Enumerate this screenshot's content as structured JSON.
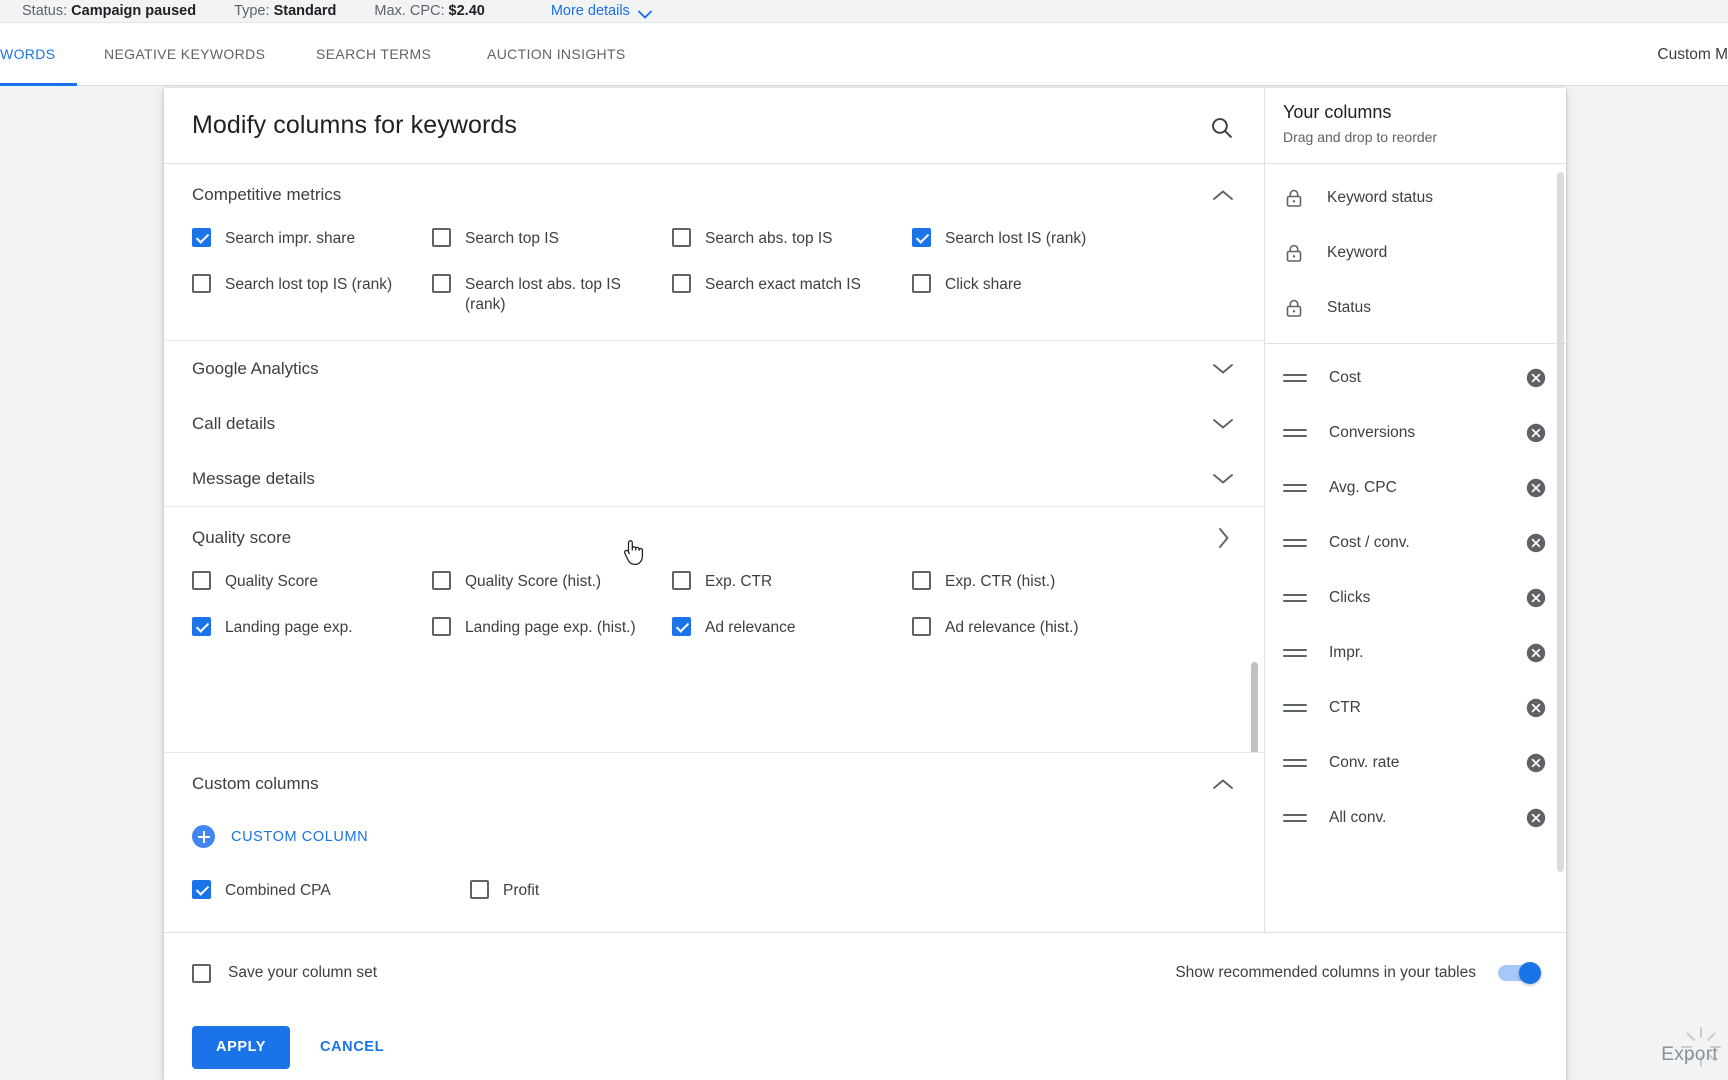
{
  "status_bar": {
    "status_key": "Status:",
    "status_value": "Campaign paused",
    "type_key": "Type:",
    "type_value": "Standard",
    "cpc_key": "Max. CPC:",
    "cpc_value": "$2.40",
    "more_details": "More details",
    "chevron_icon": "chevron-down-icon"
  },
  "tabs": [
    {
      "label": "WORDS",
      "active": true
    },
    {
      "label": "NEGATIVE KEYWORDS",
      "active": false
    },
    {
      "label": "SEARCH TERMS",
      "active": false
    },
    {
      "label": "AUCTION INSIGHTS",
      "active": false
    }
  ],
  "date_range": "Custom  M",
  "dialog": {
    "title": "Modify columns for keywords",
    "search_icon": "search-icon",
    "sections": [
      {
        "name": "Competitive metrics",
        "state": "expanded",
        "chevron": "chevron-up-icon",
        "items": [
          {
            "label": "Search impr. share",
            "checked": true
          },
          {
            "label": "Search top IS",
            "checked": false
          },
          {
            "label": "Search abs. top IS",
            "checked": false
          },
          {
            "label": "Search lost IS (rank)",
            "checked": true
          },
          {
            "label": "Search lost top IS (rank)",
            "checked": false
          },
          {
            "label": "Search lost abs. top IS (rank)",
            "checked": false
          },
          {
            "label": "Search exact match IS",
            "checked": false
          },
          {
            "label": "Click share",
            "checked": false
          }
        ]
      },
      {
        "name": "Google Analytics",
        "state": "collapsed",
        "chevron": "chevron-down-icon",
        "items": []
      },
      {
        "name": "Call details",
        "state": "collapsed",
        "chevron": "chevron-down-icon",
        "items": []
      },
      {
        "name": "Message details",
        "state": "collapsed",
        "chevron": "chevron-down-icon",
        "items": []
      },
      {
        "name": "Quality score",
        "state": "expanded",
        "chevron": "chevron-right-icon",
        "items": [
          {
            "label": "Quality Score",
            "checked": false
          },
          {
            "label": "Quality Score (hist.)",
            "checked": false
          },
          {
            "label": "Exp. CTR",
            "checked": false
          },
          {
            "label": "Exp. CTR (hist.)",
            "checked": false
          },
          {
            "label": "Landing page exp.",
            "checked": true
          },
          {
            "label": "Landing page exp. (hist.)",
            "checked": false
          },
          {
            "label": "Ad relevance",
            "checked": true
          },
          {
            "label": "Ad relevance (hist.)",
            "checked": false
          }
        ]
      }
    ],
    "custom_columns": {
      "name": "Custom columns",
      "chevron": "chevron-up-icon",
      "add_label": "CUSTOM COLUMN",
      "add_icon": "plus-circle-icon",
      "items": [
        {
          "label": "Combined CPA",
          "checked": true
        },
        {
          "label": "Profit",
          "checked": false
        }
      ]
    },
    "footer": {
      "save_set_label": "Save your column set",
      "save_set_checked": false,
      "recommend_label": "Show recommended columns in your tables",
      "recommend_on": true,
      "apply_label": "APPLY",
      "cancel_label": "CANCEL"
    }
  },
  "your_columns": {
    "title": "Your columns",
    "subtitle": "Drag and drop to reorder",
    "locked": [
      {
        "label": "Keyword status",
        "icon": "lock-icon"
      },
      {
        "label": "Keyword",
        "icon": "lock-icon"
      },
      {
        "label": "Status",
        "icon": "lock-icon"
      }
    ],
    "reorderable": [
      {
        "label": "Cost",
        "handle": "drag-handle-icon",
        "remove": "remove-circle-icon"
      },
      {
        "label": "Conversions",
        "handle": "drag-handle-icon",
        "remove": "remove-circle-icon"
      },
      {
        "label": "Avg. CPC",
        "handle": "drag-handle-icon",
        "remove": "remove-circle-icon"
      },
      {
        "label": "Cost / conv.",
        "handle": "drag-handle-icon",
        "remove": "remove-circle-icon"
      },
      {
        "label": "Clicks",
        "handle": "drag-handle-icon",
        "remove": "remove-circle-icon"
      },
      {
        "label": "Impr.",
        "handle": "drag-handle-icon",
        "remove": "remove-circle-icon"
      },
      {
        "label": "CTR",
        "handle": "drag-handle-icon",
        "remove": "remove-circle-icon"
      },
      {
        "label": "Conv. rate",
        "handle": "drag-handle-icon",
        "remove": "remove-circle-icon"
      },
      {
        "label": "All conv.",
        "handle": "drag-handle-icon",
        "remove": "remove-circle-icon"
      }
    ]
  },
  "background": {
    "export_label": "Export"
  },
  "colors": {
    "accent": "#1a73e8",
    "text_primary": "#202124",
    "text_secondary": "#5f6368",
    "surface": "#ffffff",
    "backdrop": "#f1f3f4",
    "divider": "#e0e0e0"
  }
}
